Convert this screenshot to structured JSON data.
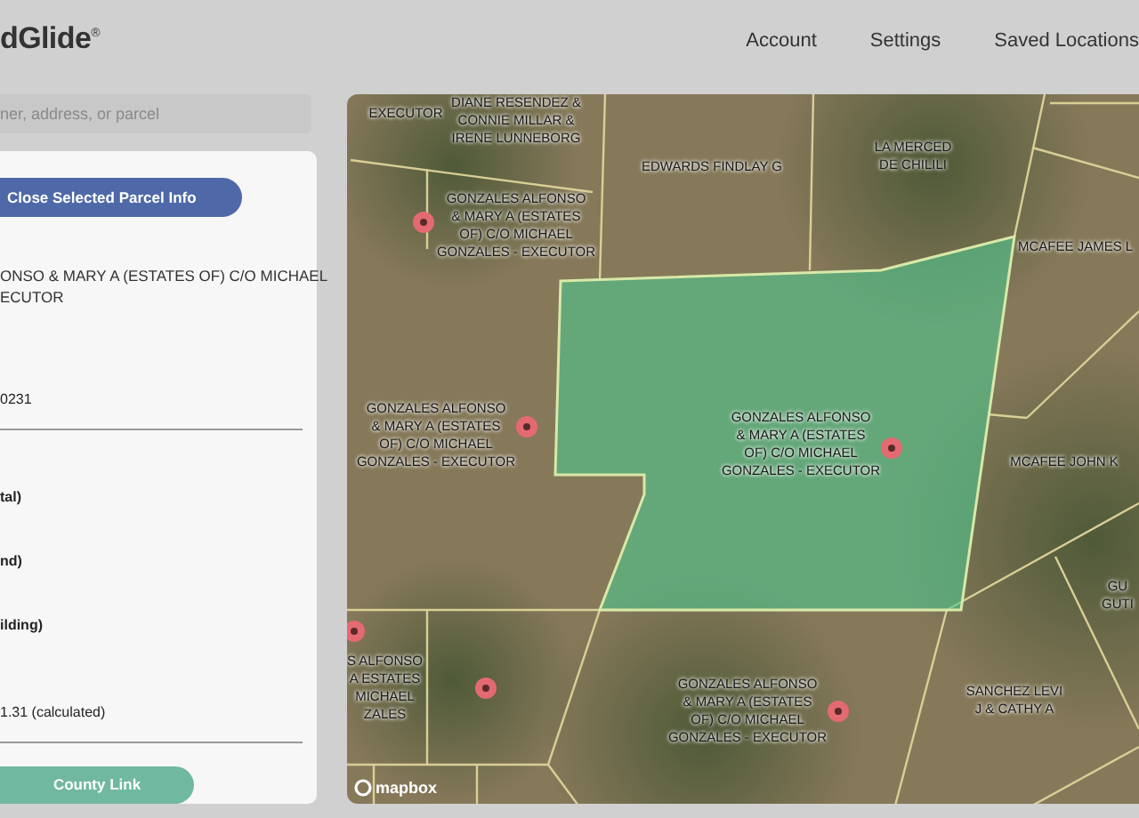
{
  "header": {
    "logo": "dGlide$^{®}$",
    "nav": [
      {
        "label": "Account"
      },
      {
        "label": "Settings"
      },
      {
        "label": "Saved Locations"
      }
    ]
  },
  "search": {
    "placeholder": "ner, address, or parcel"
  },
  "parcel_panel": {
    "close_button": "Close Selected Parcel Info",
    "owner_lines": [
      "ONSO & MARY A (ESTATES OF) C/O MICHAEL",
      "ECUTOR"
    ],
    "fields": [
      {
        "kind": "value",
        "text": "0231"
      },
      {
        "kind": "label",
        "text": "tal)"
      },
      {
        "kind": "label",
        "text": "nd)"
      },
      {
        "kind": "label",
        "text": "ilding)"
      },
      {
        "kind": "value",
        "text": "1.31 (calculated)"
      }
    ],
    "county_link_button": "County Link"
  },
  "map": {
    "labels": [
      {
        "lines": [
          "EXECUTOR"
        ]
      },
      {
        "lines": [
          "DIANE RESENDEZ &",
          "CONNIE MILLAR &",
          "IRENE LUNNEBORG"
        ]
      },
      {
        "lines": [
          "EDWARDS FINDLAY G"
        ]
      },
      {
        "lines": [
          "LA MERCED",
          "DE CHILILI"
        ]
      },
      {
        "lines": [
          "GONZALES ALFONSO",
          "& MARY A (ESTATES",
          "OF) C/O MICHAEL",
          "GONZALES - EXECUTOR"
        ]
      },
      {
        "lines": [
          "MCAFEE JAMES L"
        ]
      },
      {
        "lines": [
          "GONZALES ALFONSO",
          "& MARY A (ESTATES",
          "OF) C/O MICHAEL",
          "GONZALES - EXECUTOR"
        ]
      },
      {
        "lines": [
          "GONZALES ALFONSO",
          "& MARY A (ESTATES",
          "OF) C/O MICHAEL",
          "GONZALES - EXECUTOR"
        ]
      },
      {
        "lines": [
          "MCAFEE JOHN K"
        ]
      },
      {
        "lines": [
          "GU",
          "GUTI"
        ]
      },
      {
        "lines": [
          "S ALFONSO",
          "A ESTATES",
          "MICHAEL",
          "ZALES"
        ]
      },
      {
        "lines": [
          "GONZALES ALFONSO",
          "& MARY A (ESTATES",
          "OF) C/O MICHAEL",
          "GONZALES - EXECUTOR"
        ]
      },
      {
        "lines": [
          "SANCHEZ LEVI",
          "J & CATHY A"
        ]
      }
    ],
    "attribution": "mapbox"
  }
}
